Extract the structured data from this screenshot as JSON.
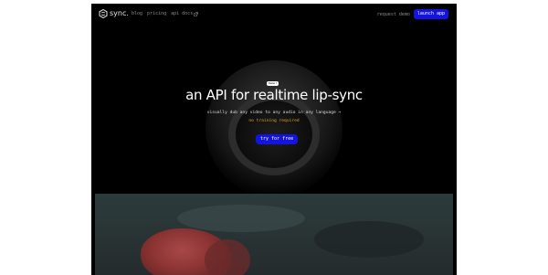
{
  "nav": {
    "logo_text": "sync.",
    "links": [
      {
        "label": "blog"
      },
      {
        "label": "pricing"
      },
      {
        "label": "api docs"
      }
    ],
    "request_demo": "request demo",
    "launch_app": "launch app"
  },
  "hero": {
    "badge": "Demo!",
    "headline": "an API for realtime lip-sync",
    "subline": "visually dub any video to any audio in any language →",
    "tagline": "no training required",
    "cta": "try for free"
  },
  "colors": {
    "accent": "#1414e0",
    "background": "#000000",
    "tagline": "#e0a020"
  }
}
